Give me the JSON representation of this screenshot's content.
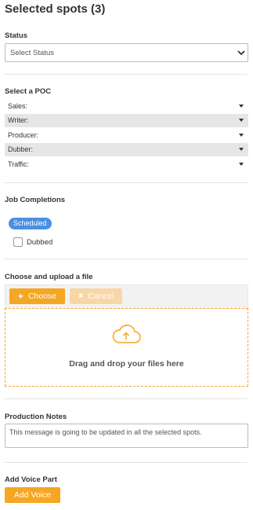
{
  "header": {
    "title": "Selected spots (3)"
  },
  "status": {
    "label": "Status",
    "select": {
      "value": "Select Status"
    }
  },
  "poc": {
    "label": "Select a POC",
    "items": [
      {
        "label": "Sales:",
        "shaded": false
      },
      {
        "label": "Writer:",
        "shaded": true
      },
      {
        "label": "Producer:",
        "shaded": false
      },
      {
        "label": "Dubber:",
        "shaded": true
      },
      {
        "label": "Traffic:",
        "shaded": false
      }
    ]
  },
  "job_completions": {
    "label": "Job Completions",
    "badge": "Scheduled",
    "checkbox": {
      "label": "Dubbed",
      "checked": false
    }
  },
  "upload": {
    "label": "Choose and upload a file",
    "choose_label": "Choose",
    "cancel_label": "Cancel",
    "dropzone_text": "Drag and drop your files here"
  },
  "notes": {
    "label": "Production Notes",
    "value": "This message is going to be updated in all the selected spots."
  },
  "voice": {
    "label": "Add Voice Part",
    "button_label": "Add Voice"
  },
  "colors": {
    "accent": "#f5a623",
    "accent_disabled": "#f8d7a7",
    "badge": "#4a90e2",
    "row_shade": "#e6e6e6"
  }
}
